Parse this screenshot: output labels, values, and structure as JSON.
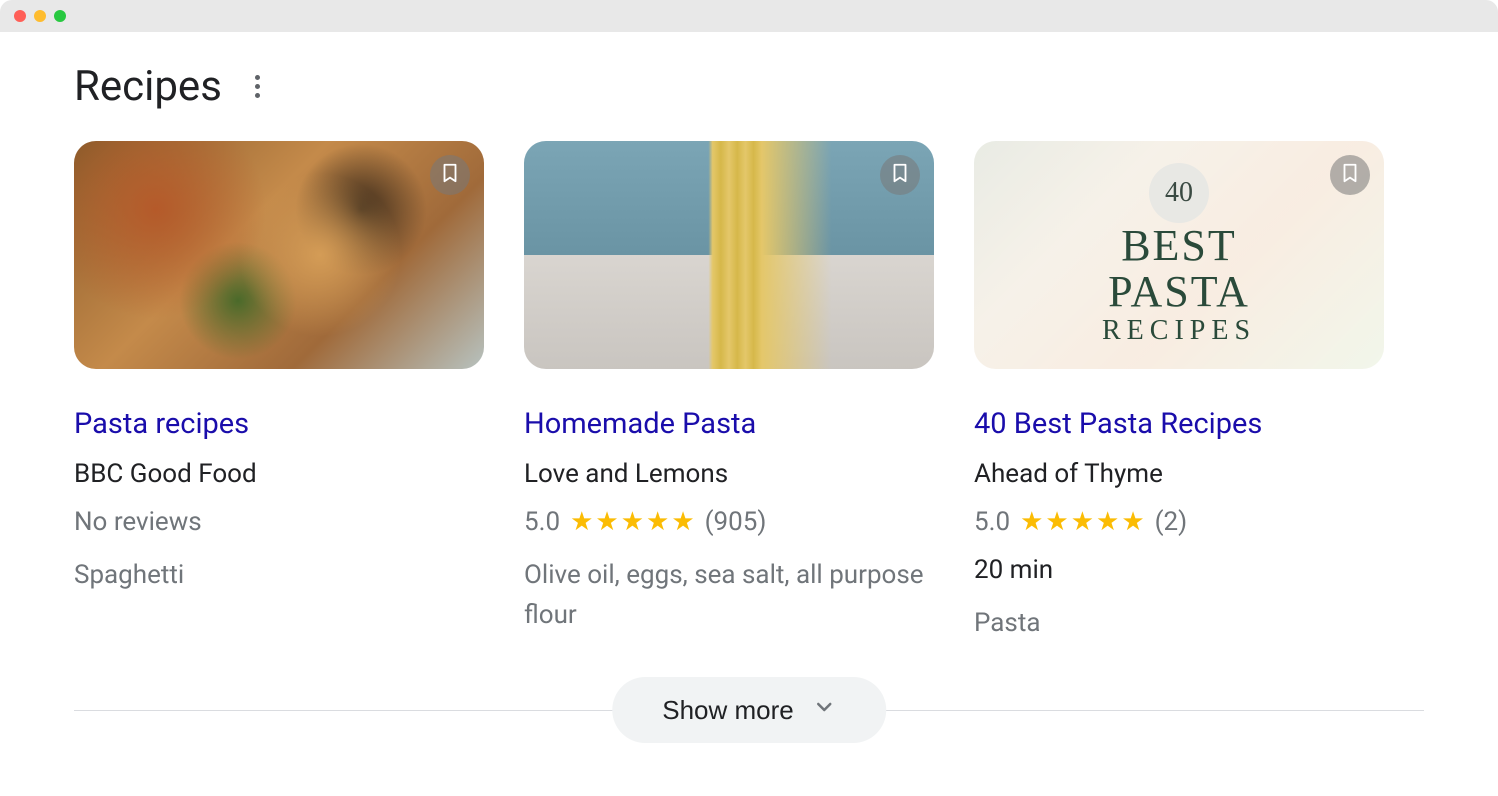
{
  "section_title": "Recipes",
  "show_more_label": "Show more",
  "cards": [
    {
      "title": "Pasta recipes",
      "source": "BBC Good Food",
      "rating_text": "No reviews",
      "rating": null,
      "reviews_count": null,
      "time": null,
      "extra": "Spaghetti",
      "extra2": null,
      "overlay": null
    },
    {
      "title": "Homemade Pasta",
      "source": "Love and Lemons",
      "rating_text": "5.0",
      "rating": 5.0,
      "reviews_count": "(905)",
      "time": null,
      "extra": "Olive oil, eggs, sea salt, all purpose flour",
      "extra2": null,
      "overlay": null
    },
    {
      "title": "40 Best Pasta Recipes",
      "source": "Ahead of Thyme",
      "rating_text": "5.0",
      "rating": 5.0,
      "reviews_count": "(2)",
      "time": "20 min",
      "extra": null,
      "extra2": "Pasta",
      "overlay": {
        "badge": "40",
        "line1": "BEST",
        "line2": "PASTA",
        "line3": "RECIPES"
      }
    }
  ]
}
